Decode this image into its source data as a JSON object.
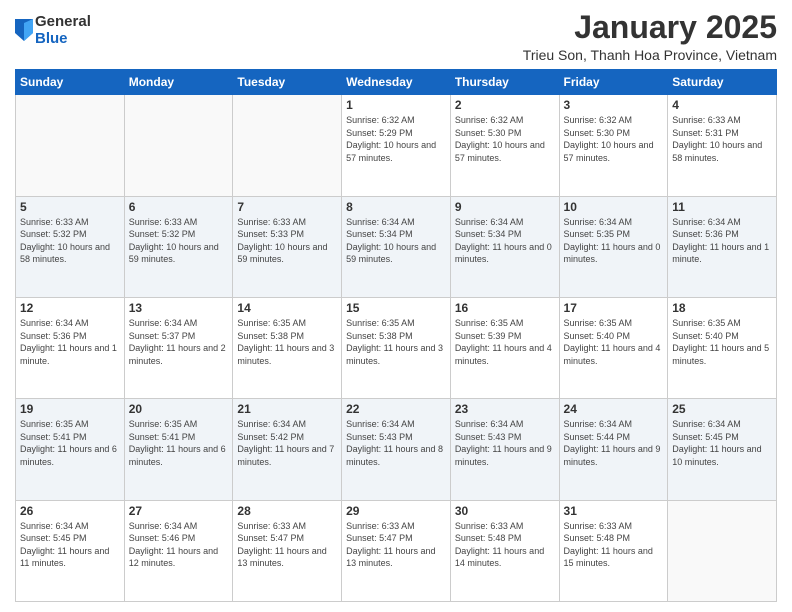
{
  "logo": {
    "general": "General",
    "blue": "Blue"
  },
  "header": {
    "month": "January 2025",
    "location": "Trieu Son, Thanh Hoa Province, Vietnam"
  },
  "days_of_week": [
    "Sunday",
    "Monday",
    "Tuesday",
    "Wednesday",
    "Thursday",
    "Friday",
    "Saturday"
  ],
  "weeks": [
    [
      {
        "day": "",
        "info": ""
      },
      {
        "day": "",
        "info": ""
      },
      {
        "day": "",
        "info": ""
      },
      {
        "day": "1",
        "info": "Sunrise: 6:32 AM\nSunset: 5:29 PM\nDaylight: 10 hours and 57 minutes."
      },
      {
        "day": "2",
        "info": "Sunrise: 6:32 AM\nSunset: 5:30 PM\nDaylight: 10 hours and 57 minutes."
      },
      {
        "day": "3",
        "info": "Sunrise: 6:32 AM\nSunset: 5:30 PM\nDaylight: 10 hours and 57 minutes."
      },
      {
        "day": "4",
        "info": "Sunrise: 6:33 AM\nSunset: 5:31 PM\nDaylight: 10 hours and 58 minutes."
      }
    ],
    [
      {
        "day": "5",
        "info": "Sunrise: 6:33 AM\nSunset: 5:32 PM\nDaylight: 10 hours and 58 minutes."
      },
      {
        "day": "6",
        "info": "Sunrise: 6:33 AM\nSunset: 5:32 PM\nDaylight: 10 hours and 59 minutes."
      },
      {
        "day": "7",
        "info": "Sunrise: 6:33 AM\nSunset: 5:33 PM\nDaylight: 10 hours and 59 minutes."
      },
      {
        "day": "8",
        "info": "Sunrise: 6:34 AM\nSunset: 5:34 PM\nDaylight: 10 hours and 59 minutes."
      },
      {
        "day": "9",
        "info": "Sunrise: 6:34 AM\nSunset: 5:34 PM\nDaylight: 11 hours and 0 minutes."
      },
      {
        "day": "10",
        "info": "Sunrise: 6:34 AM\nSunset: 5:35 PM\nDaylight: 11 hours and 0 minutes."
      },
      {
        "day": "11",
        "info": "Sunrise: 6:34 AM\nSunset: 5:36 PM\nDaylight: 11 hours and 1 minute."
      }
    ],
    [
      {
        "day": "12",
        "info": "Sunrise: 6:34 AM\nSunset: 5:36 PM\nDaylight: 11 hours and 1 minute."
      },
      {
        "day": "13",
        "info": "Sunrise: 6:34 AM\nSunset: 5:37 PM\nDaylight: 11 hours and 2 minutes."
      },
      {
        "day": "14",
        "info": "Sunrise: 6:35 AM\nSunset: 5:38 PM\nDaylight: 11 hours and 3 minutes."
      },
      {
        "day": "15",
        "info": "Sunrise: 6:35 AM\nSunset: 5:38 PM\nDaylight: 11 hours and 3 minutes."
      },
      {
        "day": "16",
        "info": "Sunrise: 6:35 AM\nSunset: 5:39 PM\nDaylight: 11 hours and 4 minutes."
      },
      {
        "day": "17",
        "info": "Sunrise: 6:35 AM\nSunset: 5:40 PM\nDaylight: 11 hours and 4 minutes."
      },
      {
        "day": "18",
        "info": "Sunrise: 6:35 AM\nSunset: 5:40 PM\nDaylight: 11 hours and 5 minutes."
      }
    ],
    [
      {
        "day": "19",
        "info": "Sunrise: 6:35 AM\nSunset: 5:41 PM\nDaylight: 11 hours and 6 minutes."
      },
      {
        "day": "20",
        "info": "Sunrise: 6:35 AM\nSunset: 5:41 PM\nDaylight: 11 hours and 6 minutes."
      },
      {
        "day": "21",
        "info": "Sunrise: 6:34 AM\nSunset: 5:42 PM\nDaylight: 11 hours and 7 minutes."
      },
      {
        "day": "22",
        "info": "Sunrise: 6:34 AM\nSunset: 5:43 PM\nDaylight: 11 hours and 8 minutes."
      },
      {
        "day": "23",
        "info": "Sunrise: 6:34 AM\nSunset: 5:43 PM\nDaylight: 11 hours and 9 minutes."
      },
      {
        "day": "24",
        "info": "Sunrise: 6:34 AM\nSunset: 5:44 PM\nDaylight: 11 hours and 9 minutes."
      },
      {
        "day": "25",
        "info": "Sunrise: 6:34 AM\nSunset: 5:45 PM\nDaylight: 11 hours and 10 minutes."
      }
    ],
    [
      {
        "day": "26",
        "info": "Sunrise: 6:34 AM\nSunset: 5:45 PM\nDaylight: 11 hours and 11 minutes."
      },
      {
        "day": "27",
        "info": "Sunrise: 6:34 AM\nSunset: 5:46 PM\nDaylight: 11 hours and 12 minutes."
      },
      {
        "day": "28",
        "info": "Sunrise: 6:33 AM\nSunset: 5:47 PM\nDaylight: 11 hours and 13 minutes."
      },
      {
        "day": "29",
        "info": "Sunrise: 6:33 AM\nSunset: 5:47 PM\nDaylight: 11 hours and 13 minutes."
      },
      {
        "day": "30",
        "info": "Sunrise: 6:33 AM\nSunset: 5:48 PM\nDaylight: 11 hours and 14 minutes."
      },
      {
        "day": "31",
        "info": "Sunrise: 6:33 AM\nSunset: 5:48 PM\nDaylight: 11 hours and 15 minutes."
      },
      {
        "day": "",
        "info": ""
      }
    ]
  ]
}
